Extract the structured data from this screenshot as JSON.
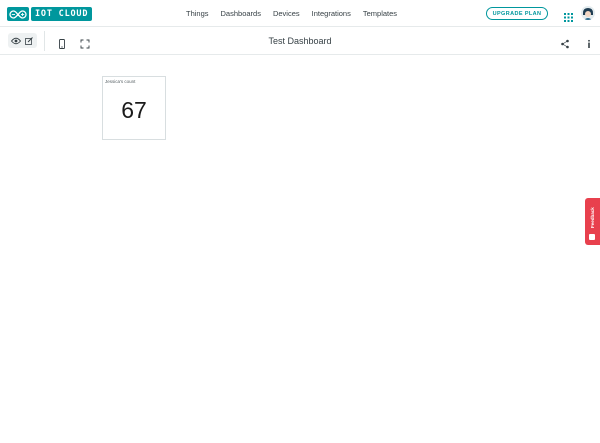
{
  "header": {
    "logo_text": "IOT CLOUD",
    "nav": [
      "Things",
      "Dashboards",
      "Devices",
      "Integrations",
      "Templates"
    ],
    "upgrade_label": "UPGRADE PLAN",
    "accent_color": "#00979d"
  },
  "toolbar": {
    "title": "Test Dashboard",
    "icons": [
      "eye-icon",
      "edit-icon",
      "mobile-icon",
      "fullscreen-icon",
      "share-icon",
      "info-icon"
    ]
  },
  "widget": {
    "title": "Jessica's count",
    "value": "67"
  },
  "feedback": {
    "label": "Feedback",
    "color": "#e8404d"
  }
}
